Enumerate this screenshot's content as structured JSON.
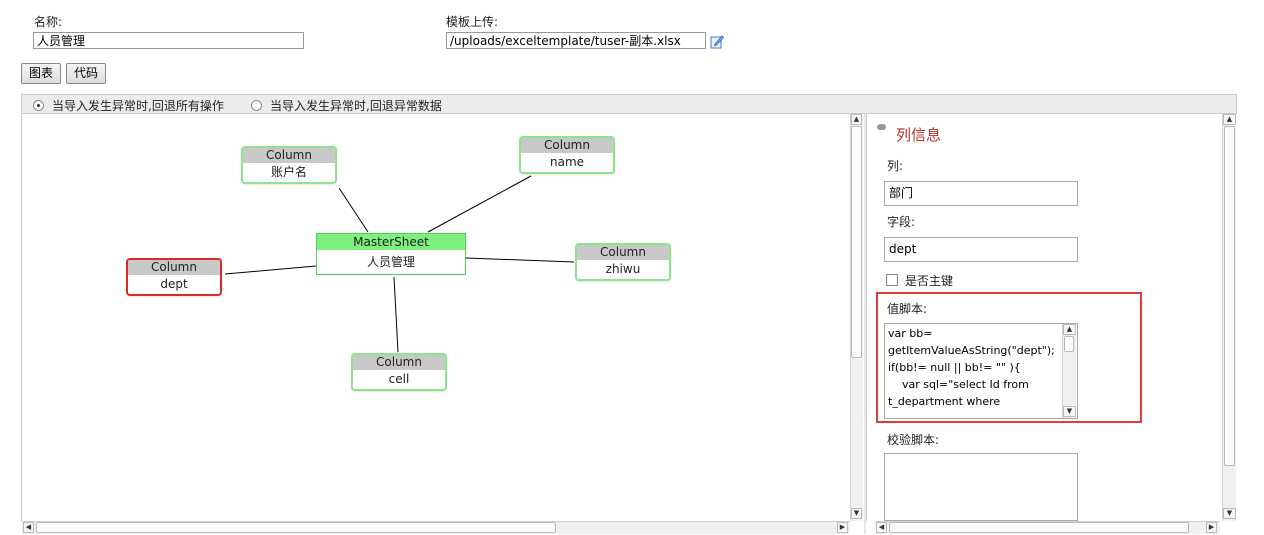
{
  "form": {
    "name_label": "名称:",
    "name_value": "人员管理",
    "template_label": "模板上传:",
    "template_value": "/uploads/exceltemplate/tuser-副本.xlsx"
  },
  "tabs": {
    "chart": "图表",
    "code": "代码"
  },
  "options": {
    "rollback_all": "当导入发生异常时,回退所有操作",
    "rollback_error": "当导入发生异常时,回退异常数据",
    "selected": "rollback_all"
  },
  "diagram": {
    "master": {
      "title": "MasterSheet",
      "name": "人员管理"
    },
    "columns": [
      {
        "id": "account",
        "title": "Column",
        "name": "账户名",
        "error": false
      },
      {
        "id": "name",
        "title": "Column",
        "name": "name",
        "error": false
      },
      {
        "id": "dept",
        "title": "Column",
        "name": "dept",
        "error": true
      },
      {
        "id": "zhiwu",
        "title": "Column",
        "name": "zhiwu",
        "error": false
      },
      {
        "id": "cell",
        "title": "Column",
        "name": "cell",
        "error": false
      }
    ]
  },
  "panel": {
    "title": "列信息",
    "column_label": "列:",
    "column_value": "部门",
    "field_label": "字段:",
    "field_value": "dept",
    "primary_key_label": "是否主键",
    "primary_key_checked": false,
    "value_script_label": "值脚本:",
    "value_script_lines": [
      "var bb=",
      "getItemValueAsString(\"dept\");",
      "if(bb!= null || bb!= \"\" ){",
      "    var sql=\"select Id from",
      "t_department where"
    ],
    "validate_script_label": "校验脚本:",
    "validate_script_value": ""
  },
  "colors": {
    "node_border": "#8ee38e",
    "node_error_border": "#d92a2a",
    "master_header": "#7ef07e",
    "highlight_box": "#e03c3c",
    "panel_title": "#b03030"
  }
}
